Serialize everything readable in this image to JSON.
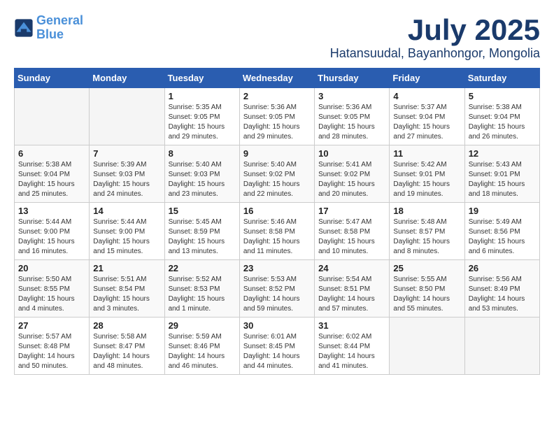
{
  "logo": {
    "line1": "General",
    "line2": "Blue"
  },
  "title": "July 2025",
  "subtitle": "Hatansuudal, Bayanhongor, Mongolia",
  "weekdays": [
    "Sunday",
    "Monday",
    "Tuesday",
    "Wednesday",
    "Thursday",
    "Friday",
    "Saturday"
  ],
  "weeks": [
    [
      {
        "day": "",
        "info": ""
      },
      {
        "day": "",
        "info": ""
      },
      {
        "day": "1",
        "info": "Sunrise: 5:35 AM\nSunset: 9:05 PM\nDaylight: 15 hours\nand 29 minutes."
      },
      {
        "day": "2",
        "info": "Sunrise: 5:36 AM\nSunset: 9:05 PM\nDaylight: 15 hours\nand 29 minutes."
      },
      {
        "day": "3",
        "info": "Sunrise: 5:36 AM\nSunset: 9:05 PM\nDaylight: 15 hours\nand 28 minutes."
      },
      {
        "day": "4",
        "info": "Sunrise: 5:37 AM\nSunset: 9:04 PM\nDaylight: 15 hours\nand 27 minutes."
      },
      {
        "day": "5",
        "info": "Sunrise: 5:38 AM\nSunset: 9:04 PM\nDaylight: 15 hours\nand 26 minutes."
      }
    ],
    [
      {
        "day": "6",
        "info": "Sunrise: 5:38 AM\nSunset: 9:04 PM\nDaylight: 15 hours\nand 25 minutes."
      },
      {
        "day": "7",
        "info": "Sunrise: 5:39 AM\nSunset: 9:03 PM\nDaylight: 15 hours\nand 24 minutes."
      },
      {
        "day": "8",
        "info": "Sunrise: 5:40 AM\nSunset: 9:03 PM\nDaylight: 15 hours\nand 23 minutes."
      },
      {
        "day": "9",
        "info": "Sunrise: 5:40 AM\nSunset: 9:02 PM\nDaylight: 15 hours\nand 22 minutes."
      },
      {
        "day": "10",
        "info": "Sunrise: 5:41 AM\nSunset: 9:02 PM\nDaylight: 15 hours\nand 20 minutes."
      },
      {
        "day": "11",
        "info": "Sunrise: 5:42 AM\nSunset: 9:01 PM\nDaylight: 15 hours\nand 19 minutes."
      },
      {
        "day": "12",
        "info": "Sunrise: 5:43 AM\nSunset: 9:01 PM\nDaylight: 15 hours\nand 18 minutes."
      }
    ],
    [
      {
        "day": "13",
        "info": "Sunrise: 5:44 AM\nSunset: 9:00 PM\nDaylight: 15 hours\nand 16 minutes."
      },
      {
        "day": "14",
        "info": "Sunrise: 5:44 AM\nSunset: 9:00 PM\nDaylight: 15 hours\nand 15 minutes."
      },
      {
        "day": "15",
        "info": "Sunrise: 5:45 AM\nSunset: 8:59 PM\nDaylight: 15 hours\nand 13 minutes."
      },
      {
        "day": "16",
        "info": "Sunrise: 5:46 AM\nSunset: 8:58 PM\nDaylight: 15 hours\nand 11 minutes."
      },
      {
        "day": "17",
        "info": "Sunrise: 5:47 AM\nSunset: 8:58 PM\nDaylight: 15 hours\nand 10 minutes."
      },
      {
        "day": "18",
        "info": "Sunrise: 5:48 AM\nSunset: 8:57 PM\nDaylight: 15 hours\nand 8 minutes."
      },
      {
        "day": "19",
        "info": "Sunrise: 5:49 AM\nSunset: 8:56 PM\nDaylight: 15 hours\nand 6 minutes."
      }
    ],
    [
      {
        "day": "20",
        "info": "Sunrise: 5:50 AM\nSunset: 8:55 PM\nDaylight: 15 hours\nand 4 minutes."
      },
      {
        "day": "21",
        "info": "Sunrise: 5:51 AM\nSunset: 8:54 PM\nDaylight: 15 hours\nand 3 minutes."
      },
      {
        "day": "22",
        "info": "Sunrise: 5:52 AM\nSunset: 8:53 PM\nDaylight: 15 hours\nand 1 minute."
      },
      {
        "day": "23",
        "info": "Sunrise: 5:53 AM\nSunset: 8:52 PM\nDaylight: 14 hours\nand 59 minutes."
      },
      {
        "day": "24",
        "info": "Sunrise: 5:54 AM\nSunset: 8:51 PM\nDaylight: 14 hours\nand 57 minutes."
      },
      {
        "day": "25",
        "info": "Sunrise: 5:55 AM\nSunset: 8:50 PM\nDaylight: 14 hours\nand 55 minutes."
      },
      {
        "day": "26",
        "info": "Sunrise: 5:56 AM\nSunset: 8:49 PM\nDaylight: 14 hours\nand 53 minutes."
      }
    ],
    [
      {
        "day": "27",
        "info": "Sunrise: 5:57 AM\nSunset: 8:48 PM\nDaylight: 14 hours\nand 50 minutes."
      },
      {
        "day": "28",
        "info": "Sunrise: 5:58 AM\nSunset: 8:47 PM\nDaylight: 14 hours\nand 48 minutes."
      },
      {
        "day": "29",
        "info": "Sunrise: 5:59 AM\nSunset: 8:46 PM\nDaylight: 14 hours\nand 46 minutes."
      },
      {
        "day": "30",
        "info": "Sunrise: 6:01 AM\nSunset: 8:45 PM\nDaylight: 14 hours\nand 44 minutes."
      },
      {
        "day": "31",
        "info": "Sunrise: 6:02 AM\nSunset: 8:44 PM\nDaylight: 14 hours\nand 41 minutes."
      },
      {
        "day": "",
        "info": ""
      },
      {
        "day": "",
        "info": ""
      }
    ]
  ]
}
